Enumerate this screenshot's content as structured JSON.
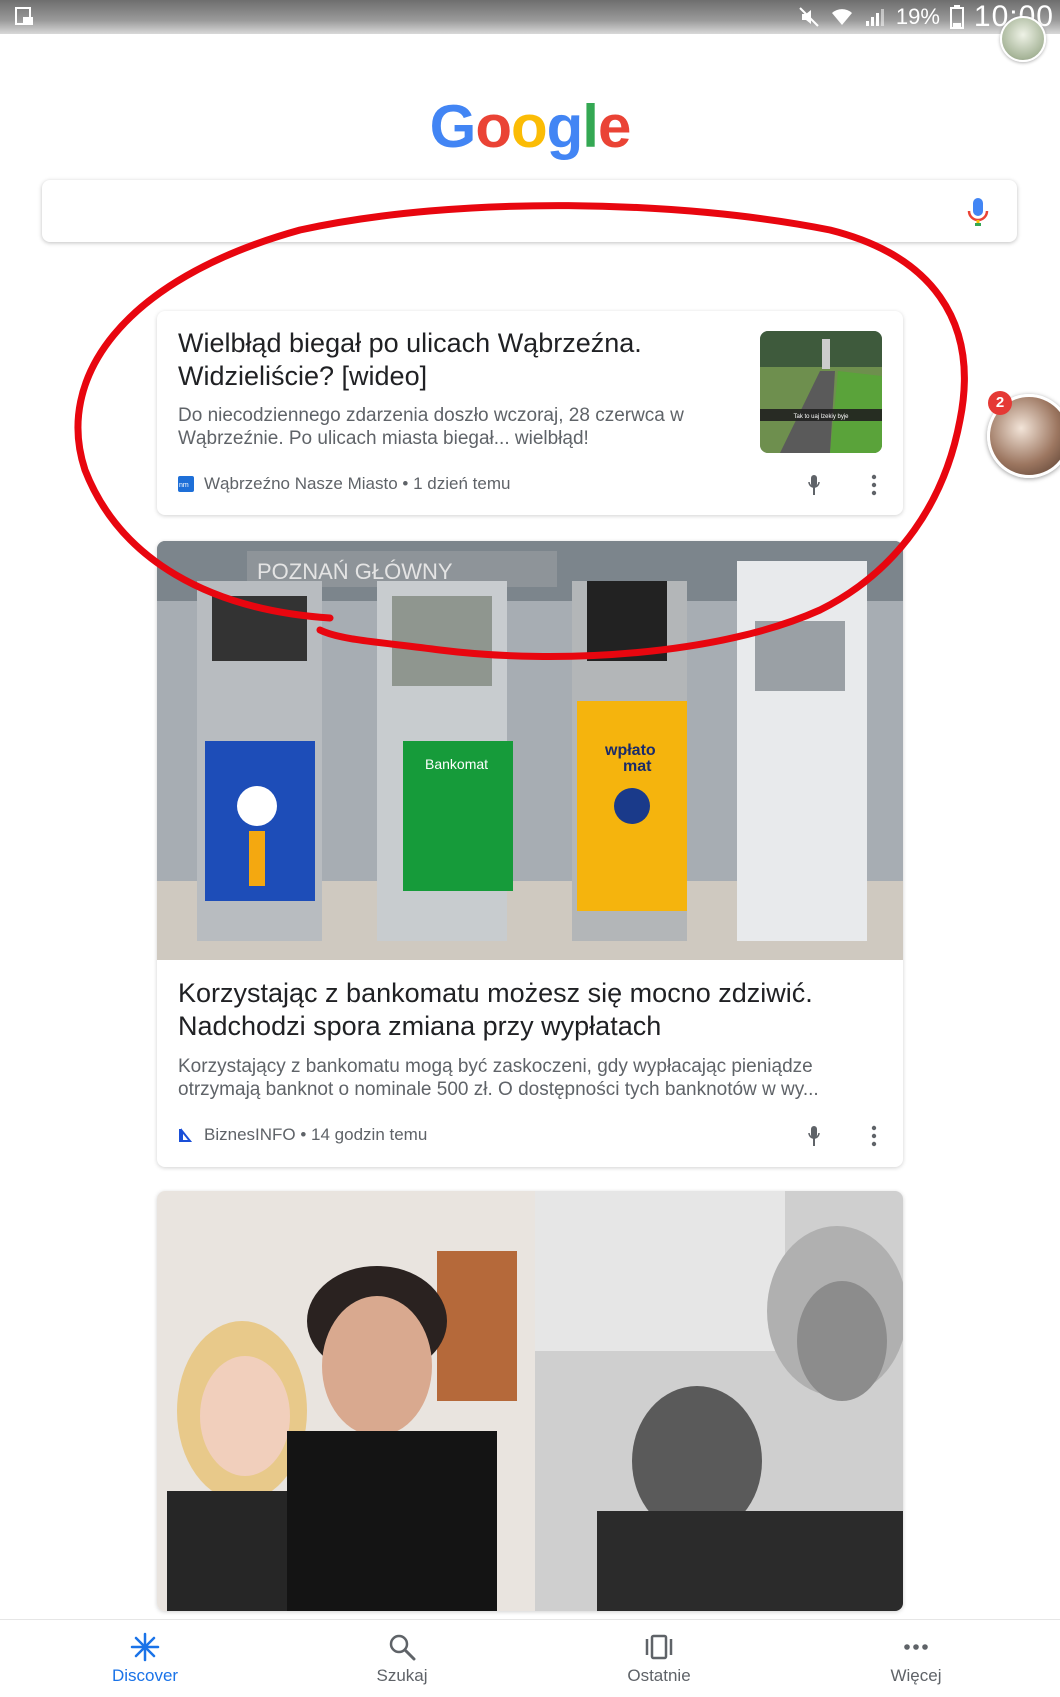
{
  "status_bar": {
    "battery": "19%",
    "time": "10:00"
  },
  "logo": {
    "letters": [
      "G",
      "o",
      "o",
      "g",
      "l",
      "e"
    ],
    "colors": [
      "#4285F4",
      "#EA4335",
      "#FBBC05",
      "#4285F4",
      "#34A853",
      "#EA4335"
    ]
  },
  "search": {
    "placeholder": "",
    "icon": "mic-icon"
  },
  "feed": [
    {
      "title_line1": "Wielbłąd biegał po ulicach Wąbrzeźna.",
      "title_line2": "Widzieliście? [wideo]",
      "snippet_line1": "Do niecodziennego zdarzenia doszło wczoraj, 28 czerwca w",
      "snippet_line2": "Wąbrzeźnie. Po ulicach miasta biegał... wielbłąd!",
      "source": "Wąbrzeźno Nasze Miasto",
      "age": "1 dzień temu",
      "thumbnail_caption": "Tak to uaj lzekiy byje"
    },
    {
      "image_text_station": "POZNAŃ GŁÓWNY",
      "image_text_atm": "Bankomat",
      "image_text_wplatomat_1": "wpłato",
      "image_text_wplatomat_2": "mat",
      "title_line1": "Korzystając z bankomatu możesz się mocno zdziwić.",
      "title_line2": "Nadchodzi spora zmiana przy wypłatach",
      "snippet_line1": "Korzystający z bankomatu mogą być zaskoczeni, gdy wypłacając pieniądze",
      "snippet_line2": "otrzymają banknot o nominale 500 zł. O dostępności tych banknotów w wy...",
      "source": "BiznesINFO",
      "age": "14 godzin temu"
    }
  ],
  "side_bubble": {
    "badge": "2"
  },
  "bottom_nav": [
    {
      "label": "Discover",
      "icon": "asterisk-icon",
      "active": true
    },
    {
      "label": "Szukaj",
      "icon": "search-icon",
      "active": false
    },
    {
      "label": "Ostatnie",
      "icon": "recent-cards-icon",
      "active": false
    },
    {
      "label": "Więcej",
      "icon": "more-dots-icon",
      "active": false
    }
  ],
  "colors": {
    "accent": "#1a73e8",
    "annotation": "#e8060f"
  }
}
